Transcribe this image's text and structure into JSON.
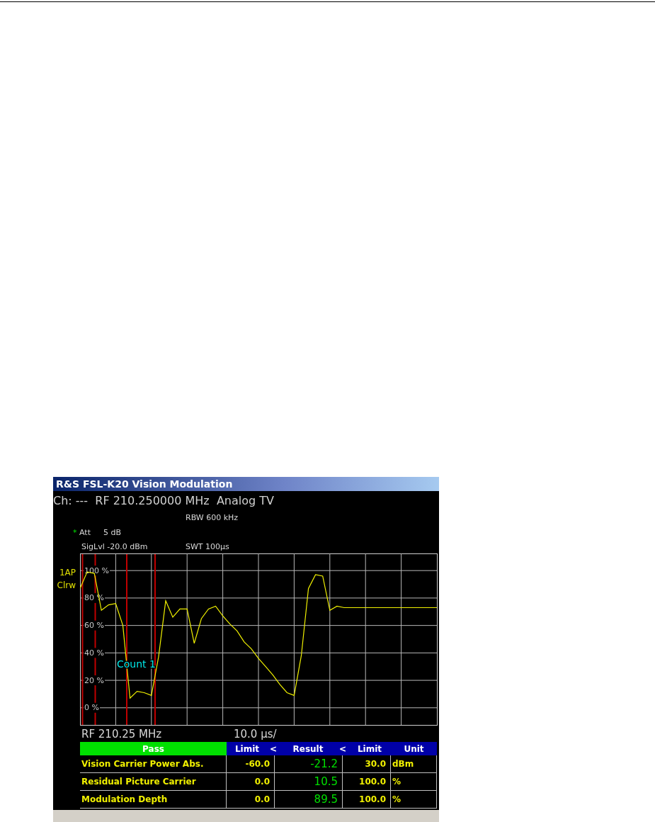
{
  "window": {
    "title": "R&S FSL-K20 Vision Modulation"
  },
  "channel_line": "Ch: ---  RF 210.250000 MHz  Analog TV",
  "settings": {
    "rbw": "RBW 600 kHz",
    "att_marker": "*",
    "att": "Att",
    "att_value": "5 dB",
    "siglvl": "SigLvl -20.0 dBm",
    "swt": "SWT 100µs"
  },
  "trace_labels": [
    "1AP",
    "Clrw"
  ],
  "marker_lines": [
    {
      "color": "#c00000"
    },
    {
      "color": "#c00000"
    },
    {
      "color": "#c00000"
    },
    {
      "color": "#c00000"
    }
  ],
  "chart": {
    "chart_data": {
      "type": "line",
      "grid": true,
      "ylim": [
        -12.5,
        112.5
      ],
      "yticks": [
        {
          "value": 100,
          "label": "100 %"
        },
        {
          "value": 80,
          "label": "80 %"
        },
        {
          "value": 60,
          "label": "60 %"
        },
        {
          "value": 40,
          "label": "40 %"
        },
        {
          "value": 20,
          "label": "20 %"
        },
        {
          "value": 0,
          "label": "0 %"
        }
      ],
      "categories": [
        null,
        null,
        null,
        null,
        null,
        null,
        null,
        null,
        null,
        null,
        null,
        null,
        null,
        null,
        null,
        null,
        null,
        null,
        null,
        null,
        null,
        null,
        null,
        null,
        null,
        null,
        null,
        null,
        null,
        null,
        null,
        null,
        null,
        null,
        null,
        null,
        null,
        null,
        null,
        null,
        null,
        null,
        null,
        null,
        null,
        null,
        null,
        null,
        null,
        null,
        null
      ],
      "series": [
        {
          "color": "#f0f000",
          "values": [
            87,
            99,
            98,
            71,
            75,
            76,
            60,
            7,
            12,
            11,
            9,
            37,
            78,
            66,
            72,
            72,
            47,
            65,
            72,
            74,
            67,
            61,
            56,
            48,
            43,
            36,
            30,
            24,
            17,
            11,
            9,
            38,
            87,
            97,
            96,
            71,
            74,
            73,
            73,
            73,
            73,
            73,
            73,
            73,
            73,
            73,
            73,
            73,
            73,
            73,
            73
          ]
        }
      ],
      "annotations": [
        {
          "text": "Count 1"
        }
      ]
    }
  },
  "footer": {
    "center": "RF 210.25 MHz",
    "span": "10.0 µs/"
  },
  "results": {
    "verdict": "Pass",
    "passed": true,
    "columns": [
      "Limit",
      "<",
      "Result",
      "<",
      "Limit",
      "Unit"
    ],
    "rows": [
      {
        "name": "Vision Carrier Power Abs.",
        "low": "-60.0",
        "result": "-21.2",
        "high": "30.0",
        "unit": "dBm"
      },
      {
        "name": "Residual Picture Carrier",
        "low": "0.0",
        "result": "10.5",
        "high": "100.0",
        "unit": "%"
      },
      {
        "name": "Modulation Depth",
        "low": "0.0",
        "result": "89.5",
        "high": "100.0",
        "unit": "%"
      }
    ]
  }
}
